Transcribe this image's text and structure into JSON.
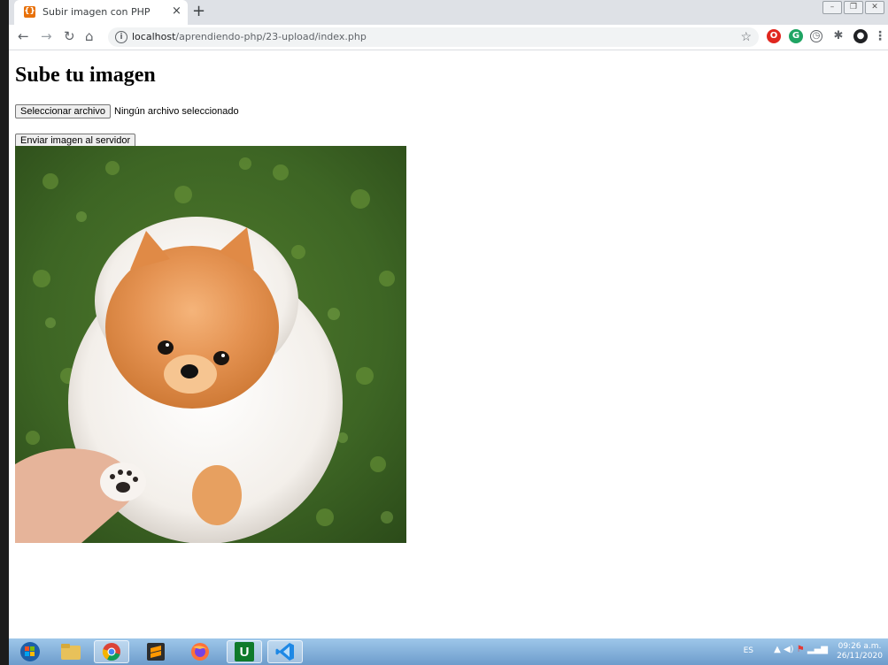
{
  "browser": {
    "tab_title": "Subir imagen con PHP",
    "tab_favicon_glyph": "{}",
    "tab_close": "×",
    "new_tab": "+",
    "url_host": "localhost",
    "url_path": "/aprendiendo-php/23-upload/index.php",
    "info_glyph": "i",
    "window_controls": [
      "–",
      "❐",
      "✕"
    ]
  },
  "page": {
    "title": "Sube tu imagen",
    "file_button": "Seleccionar archivo",
    "file_status": "Ningún archivo seleccionado",
    "submit_button": "Enviar imagen al servidor"
  },
  "taskbar": {
    "apps": [
      "windows-start",
      "file-explorer",
      "chrome",
      "sublime-text",
      "firefox",
      "uniserver",
      "vscode"
    ],
    "active_app": "chrome",
    "language": "ES",
    "time": "09:26 a.m.",
    "date": "26/11/2020"
  },
  "colors": {
    "tab_strip": "#dee1e6",
    "favicon": "#e8710a",
    "taskbar": "#7aa7d6"
  }
}
